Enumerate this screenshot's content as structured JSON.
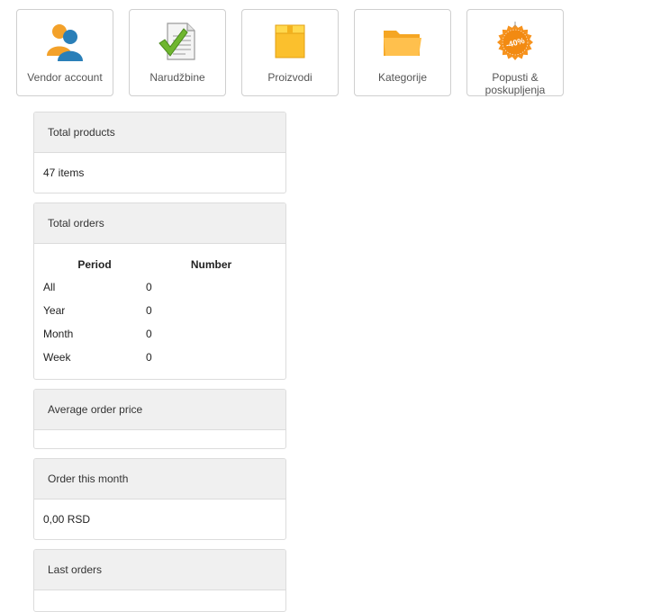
{
  "tiles": [
    {
      "label": "Vendor account",
      "icon": "users-icon"
    },
    {
      "label": "Narudžbine",
      "icon": "document-check-icon"
    },
    {
      "label": "Proizvodi",
      "icon": "box-icon"
    },
    {
      "label": "Kategorije",
      "icon": "folder-icon"
    },
    {
      "label": "Popusti & poskupljenja",
      "icon": "discount-badge-icon",
      "badge_text": "-40%"
    }
  ],
  "panels": {
    "total_products": {
      "title": "Total products",
      "value": "47 items"
    },
    "total_orders": {
      "title": "Total orders",
      "columns": [
        "Period",
        "Number"
      ],
      "rows": [
        {
          "period": "All",
          "number": "0"
        },
        {
          "period": "Year",
          "number": "0"
        },
        {
          "period": "Month",
          "number": "0"
        },
        {
          "period": "Week",
          "number": "0"
        }
      ]
    },
    "average_order_price": {
      "title": "Average order price",
      "value": ""
    },
    "order_this_month": {
      "title": "Order this month",
      "value": "0,00 RSD"
    },
    "last_orders": {
      "title": "Last orders"
    }
  },
  "colors": {
    "tile_border": "#cfcfcf",
    "panel_header_bg": "#f0f0f0",
    "accent_orange": "#f7931e",
    "user_blue": "#2a7fb8"
  }
}
